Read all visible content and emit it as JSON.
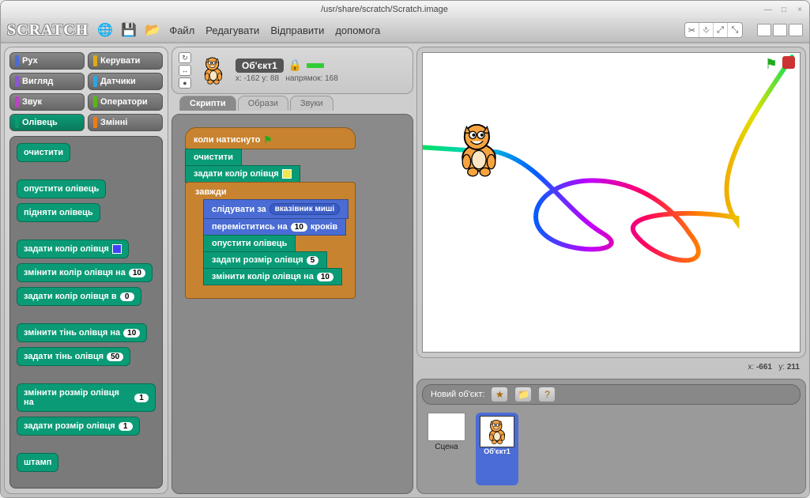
{
  "window": {
    "title": "/usr/share/scratch/Scratch.image"
  },
  "logo": "SCRATCH",
  "menus": {
    "file": "Файл",
    "edit": "Редагувати",
    "share": "Відправити",
    "help": "допомога"
  },
  "categories": [
    {
      "label": "Рух",
      "color": "#4a6cd4"
    },
    {
      "label": "Керувати",
      "color": "#e1a91a"
    },
    {
      "label": "Вигляд",
      "color": "#8a55d7"
    },
    {
      "label": "Датчики",
      "color": "#2ca5e2"
    },
    {
      "label": "Звук",
      "color": "#bb42c3"
    },
    {
      "label": "Оператори",
      "color": "#5cb712"
    },
    {
      "label": "Олівець",
      "color": "#0e9a6c",
      "active": true
    },
    {
      "label": "Змінні",
      "color": "#ee7d16"
    }
  ],
  "pen_blocks": {
    "clear": "очистити",
    "pen_down": "опустити олівець",
    "pen_up": "підняти олівець",
    "set_color": "задати колір олівця",
    "change_color_by": {
      "text": "змінити колір олівця на",
      "val": "10"
    },
    "set_color_to": {
      "text": "задати колір олівця в",
      "val": "0"
    },
    "change_shade_by": {
      "text": "змінити тінь олівця на",
      "val": "10"
    },
    "set_shade_to": {
      "text": "задати тінь олівця",
      "val": "50"
    },
    "change_size_by": {
      "text": "змінити розмір олівця на",
      "val": "1"
    },
    "set_size_to": {
      "text": "задати розмір олівця",
      "val": "1"
    },
    "stamp": "штамп"
  },
  "sprite": {
    "name": "Об'єкт1",
    "x_label": "x:",
    "x": "-162",
    "y_label": "y:",
    "y": "88",
    "dir_label": "напрямок:",
    "dir": "168"
  },
  "tabs": {
    "scripts": "Скрипти",
    "costumes": "Образи",
    "sounds": "Звуки"
  },
  "script": {
    "hat": "коли натиснуто",
    "s1": "очистити",
    "s2": "задати колір олівця",
    "forever": "завжди",
    "goto": {
      "text": "слідувати за",
      "target": "вказівник миші"
    },
    "move": {
      "pre": "переміститись на",
      "val": "10",
      "post": "кроків"
    },
    "pendown": "опустити олівець",
    "setsize": {
      "text": "задати розмір олівця",
      "val": "5"
    },
    "changecolor": {
      "text": "змінити колір олівця на",
      "val": "10"
    }
  },
  "stage": {
    "mouse_x_label": "x:",
    "mouse_x": "-661",
    "mouse_y_label": "y:",
    "mouse_y": "211",
    "new_object": "Новий об'єкт:",
    "stage_label": "Сцена",
    "sprite1_label": "Об'єкт1"
  }
}
